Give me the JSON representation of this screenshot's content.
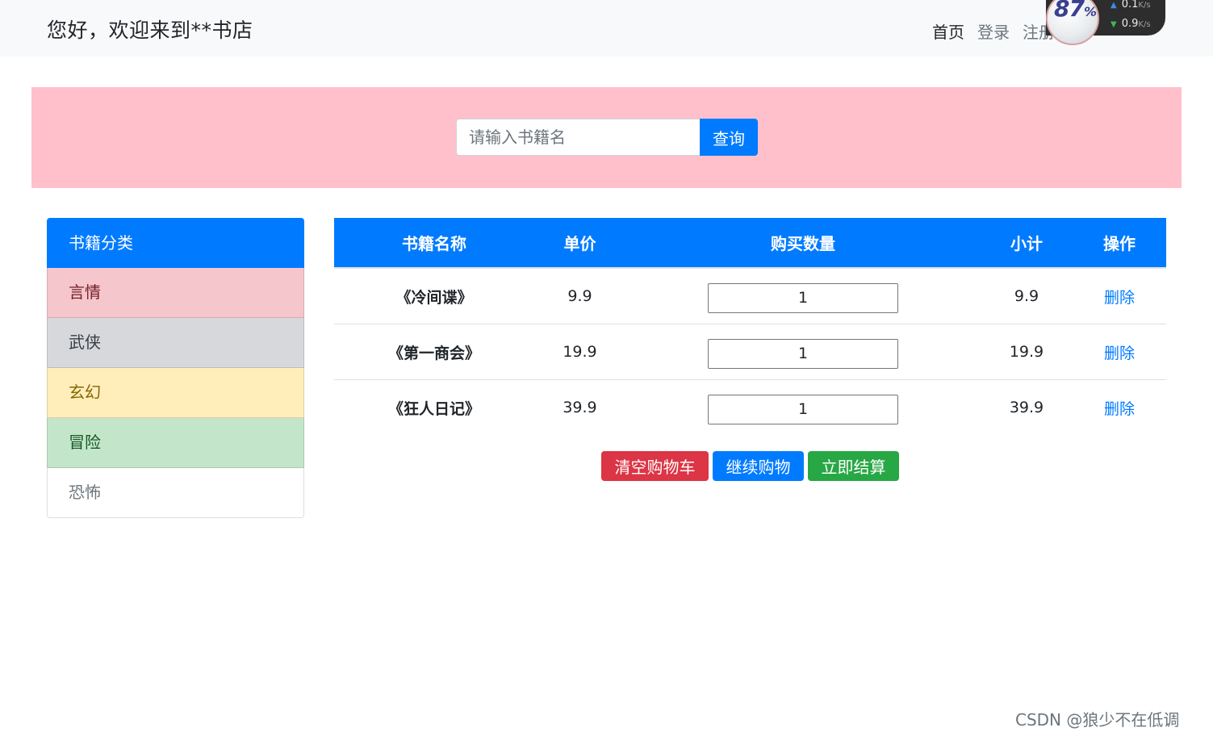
{
  "navbar": {
    "brand": "您好，欢迎来到**书店",
    "links": [
      {
        "label": "首页",
        "active": true
      },
      {
        "label": "登录",
        "active": false
      },
      {
        "label": "注册",
        "active": false
      }
    ]
  },
  "speed_widget": {
    "percent": "87",
    "percent_sign": "%",
    "upload": "0.1",
    "download": "0.9",
    "unit": "K/s"
  },
  "search": {
    "placeholder": "请输入书籍名",
    "button_label": "查询"
  },
  "sidebar": {
    "title": "书籍分类",
    "items": [
      {
        "label": "言情"
      },
      {
        "label": "武侠"
      },
      {
        "label": "玄幻"
      },
      {
        "label": "冒险"
      },
      {
        "label": "恐怖"
      }
    ]
  },
  "cart": {
    "columns": [
      "书籍名称",
      "单价",
      "购买数量",
      "小计",
      "操作"
    ],
    "rows": [
      {
        "name": "《冷间谍》",
        "price": "9.9",
        "quantity": "1",
        "subtotal": "9.9",
        "action": "删除"
      },
      {
        "name": "《第一商会》",
        "price": "19.9",
        "quantity": "1",
        "subtotal": "19.9",
        "action": "删除"
      },
      {
        "name": "《狂人日记》",
        "price": "39.9",
        "quantity": "1",
        "subtotal": "39.9",
        "action": "删除"
      }
    ],
    "buttons": {
      "clear": "清空购物车",
      "continue": "继续购物",
      "checkout": "立即结算"
    }
  },
  "watermark": "CSDN @狼少不在低调",
  "colors": {
    "primary": "#007bff",
    "danger": "#dc3545",
    "success": "#28a745",
    "banner": "#ffc0cb"
  }
}
